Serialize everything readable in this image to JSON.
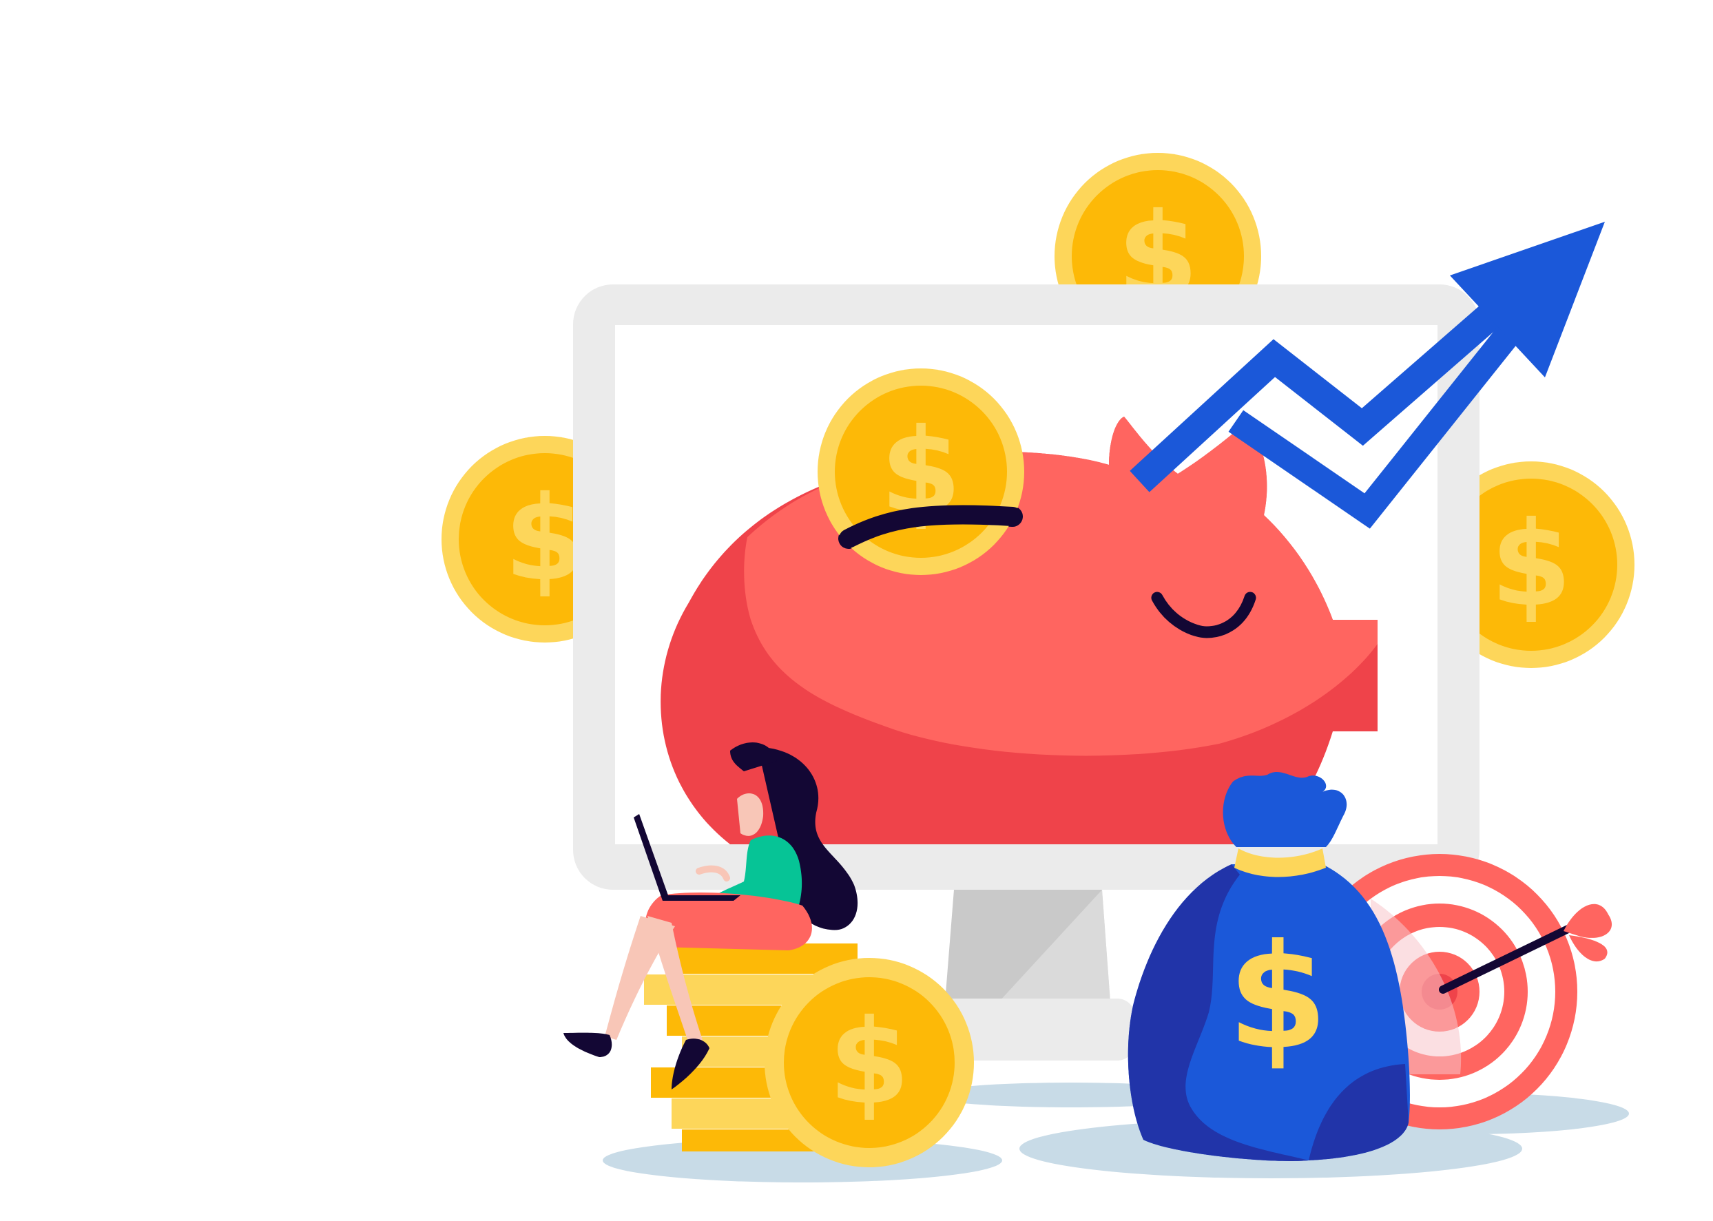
{
  "illustration": {
    "symbols": {
      "coin": "$",
      "money_bag": "$"
    },
    "colors": {
      "background": "#ffffff",
      "monitor_frame": "#ebebeb",
      "monitor_screen": "#ffffff",
      "monitor_stand": "#c9c9c9",
      "piggy_light": "#ff6560",
      "piggy_dark": "#ef434a",
      "coin_outer": "#fdd65a",
      "coin_inner": "#fdb907",
      "coin_symbol": "#fdd65a",
      "arrow": "#1b58d9",
      "bag": "#1b58d9",
      "bag_dark": "#2134a9",
      "bag_tie": "#fdd65a",
      "target_ring": "#ff6560",
      "target_light": "#f7c5cb",
      "shadow": "#c8dbe7",
      "woman_top": "#06c496",
      "woman_skirt": "#ff6560",
      "skin": "#f8c6b7",
      "hair": "#130734"
    },
    "icons": [
      "coin-icon",
      "dollar-sign-icon",
      "piggy-bank-icon",
      "growth-arrow-icon",
      "money-bag-icon",
      "target-icon",
      "dart-icon",
      "monitor-icon",
      "laptop-icon"
    ]
  }
}
